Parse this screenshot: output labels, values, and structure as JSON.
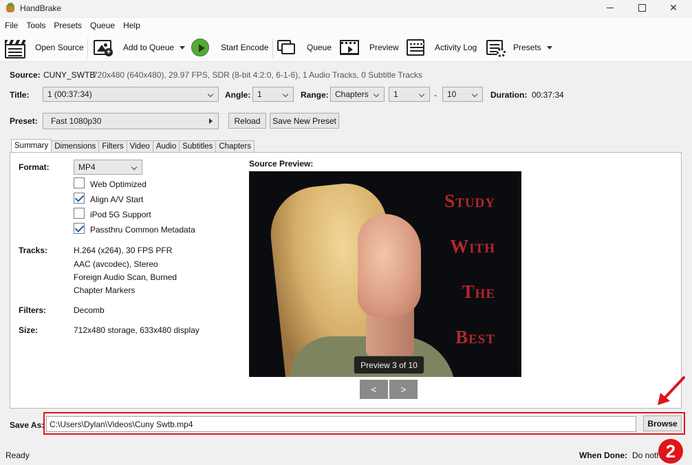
{
  "window": {
    "title": "HandBrake"
  },
  "menu": [
    "File",
    "Tools",
    "Presets",
    "Queue",
    "Help"
  ],
  "toolbar": {
    "open_source": "Open Source",
    "add_to_queue": "Add to Queue",
    "start_encode": "Start Encode",
    "queue": "Queue",
    "preview": "Preview",
    "activity_log": "Activity Log",
    "presets": "Presets"
  },
  "source": {
    "label": "Source:",
    "name": "CUNY_SWTB",
    "details": "720x480 (640x480), 29.97 FPS, SDR (8-bit 4:2:0, 6-1-6), 1 Audio Tracks, 0 Subtitle Tracks"
  },
  "title_row": {
    "title_label": "Title:",
    "title_value": "1  (00:37:34)",
    "angle_label": "Angle:",
    "angle_value": "1",
    "range_label": "Range:",
    "range_type": "Chapters",
    "range_start": "1",
    "range_dash": "-",
    "range_end": "10",
    "duration_label": "Duration:",
    "duration_value": "00:37:34"
  },
  "preset_row": {
    "label": "Preset:",
    "value": "Fast 1080p30",
    "reload": "Reload",
    "save_new": "Save New Preset"
  },
  "tabs": [
    "Summary",
    "Dimensions",
    "Filters",
    "Video",
    "Audio",
    "Subtitles",
    "Chapters"
  ],
  "summary": {
    "format_label": "Format:",
    "format_value": "MP4",
    "checkboxes": [
      {
        "label": "Web Optimized",
        "checked": false
      },
      {
        "label": "Align A/V Start",
        "checked": true
      },
      {
        "label": "iPod 5G Support",
        "checked": false
      },
      {
        "label": "Passthru Common Metadata",
        "checked": true
      }
    ],
    "tracks_label": "Tracks:",
    "tracks": [
      "H.264 (x264), 30 FPS PFR",
      "AAC (avcodec), Stereo",
      "Foreign Audio Scan, Burned",
      "Chapter Markers"
    ],
    "filters_label": "Filters:",
    "filters_value": "Decomb",
    "size_label": "Size:",
    "size_value": "712x480 storage, 633x480 display"
  },
  "source_preview": {
    "label": "Source Preview:",
    "overlay_text": [
      "Study",
      "With",
      "The",
      "Best"
    ],
    "caption": "Preview 3 of 10",
    "prev": "<",
    "next": ">"
  },
  "save_as": {
    "label": "Save As:",
    "path": "C:\\Users\\Dylan\\Videos\\Cuny Swtb.mp4",
    "browse": "Browse"
  },
  "status": {
    "state": "Ready",
    "when_done_label": "When Done:",
    "when_done_value": "Do noth"
  },
  "annotation": {
    "step_number": "2",
    "color": "#e0151b"
  }
}
